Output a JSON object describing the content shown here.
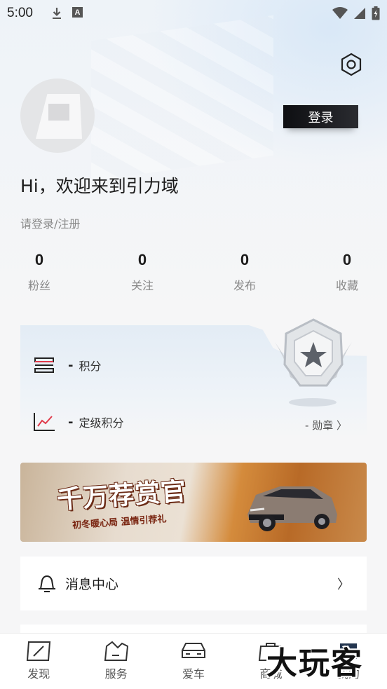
{
  "status_bar": {
    "time": "5:00",
    "download_icon": "download-icon",
    "a_icon": "A"
  },
  "header": {
    "login_label": "登录",
    "settings_icon": "gear-icon"
  },
  "profile": {
    "greeting": "Hi，欢迎来到引力域",
    "login_prompt": "请登录/注册"
  },
  "stats": [
    {
      "value": "0",
      "label": "粉丝"
    },
    {
      "value": "0",
      "label": "关注"
    },
    {
      "value": "0",
      "label": "发布"
    },
    {
      "value": "0",
      "label": "收藏"
    }
  ],
  "points": {
    "points_value": "-",
    "points_label": "积分",
    "level_value": "-",
    "level_label": "定级积分",
    "medal_link": "- 勋章 〉"
  },
  "banner": {
    "title": "千万荐赏官",
    "subtitle": "初冬暖心局 温情引荐礼"
  },
  "menu": {
    "message_center": "消息中心",
    "chevron": "〉"
  },
  "tabs": [
    {
      "label": "发现",
      "icon": "compass-icon"
    },
    {
      "label": "服务",
      "icon": "service-icon"
    },
    {
      "label": "爱车",
      "icon": "car-icon"
    },
    {
      "label": "商城",
      "icon": "shopping-bag-icon"
    },
    {
      "label": "我的",
      "icon": "profile-icon"
    }
  ],
  "watermark": "大玩客",
  "colors": {
    "accent": "#e03a4a",
    "dark": "#16171b"
  }
}
